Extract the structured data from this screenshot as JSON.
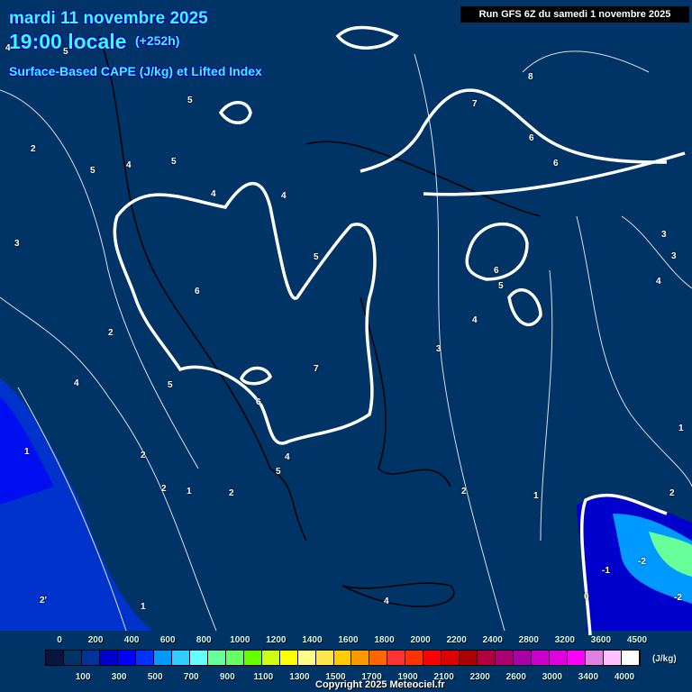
{
  "header": {
    "date": "mardi 11 novembre 2025",
    "time": "19:00 locale",
    "lead": "(+252h)",
    "parameter": "Surface-Based CAPE (J/kg) et Lifted Index"
  },
  "run_info": "Run GFS 6Z du samedi 1 novembre 2025",
  "contour_labels": [
    "5",
    "4",
    "5",
    "4",
    "5",
    "5",
    "4",
    "4",
    "2",
    "3",
    "4",
    "5",
    "6",
    "5",
    "7",
    "6",
    "5",
    "4",
    "2",
    "2",
    "1",
    "2",
    "2",
    "1",
    "1",
    "4",
    "3",
    "2",
    "1",
    "6",
    "5",
    "4",
    "8",
    "7",
    "6",
    "6",
    "3",
    "3",
    "4",
    "1",
    "2",
    "0",
    "-1",
    "-2",
    "-2",
    "2'"
  ],
  "legend": {
    "unit": "(J/kg)",
    "top_labels": [
      "0",
      "200",
      "400",
      "600",
      "800",
      "1000",
      "1200",
      "1400",
      "1600",
      "1800",
      "2000",
      "2200",
      "2400",
      "2800",
      "3200",
      "3600",
      "4500"
    ],
    "bottom_labels": [
      "100",
      "300",
      "500",
      "700",
      "900",
      "1100",
      "1300",
      "1500",
      "1700",
      "1900",
      "2100",
      "2300",
      "2600",
      "3000",
      "3400",
      "4000"
    ],
    "colors": [
      "#0a1440",
      "#003366",
      "#003399",
      "#0000cc",
      "#0000ff",
      "#0033ff",
      "#0099ff",
      "#33ccff",
      "#66ffff",
      "#66ff99",
      "#66ff66",
      "#66ff00",
      "#ccff11",
      "#ffff00",
      "#ffff88",
      "#ffe64d",
      "#ffcc00",
      "#ff9900",
      "#ff6600",
      "#ff3333",
      "#ff3300",
      "#ff0000",
      "#e00000",
      "#aa0000",
      "#b00040",
      "#aa0070",
      "#aa00aa",
      "#cc00cc",
      "#e000e0",
      "#ff00ff",
      "#e080e0",
      "#ffc0ff",
      "#ffffff"
    ]
  },
  "copyright": "Copyright 2025 Meteociel.fr"
}
